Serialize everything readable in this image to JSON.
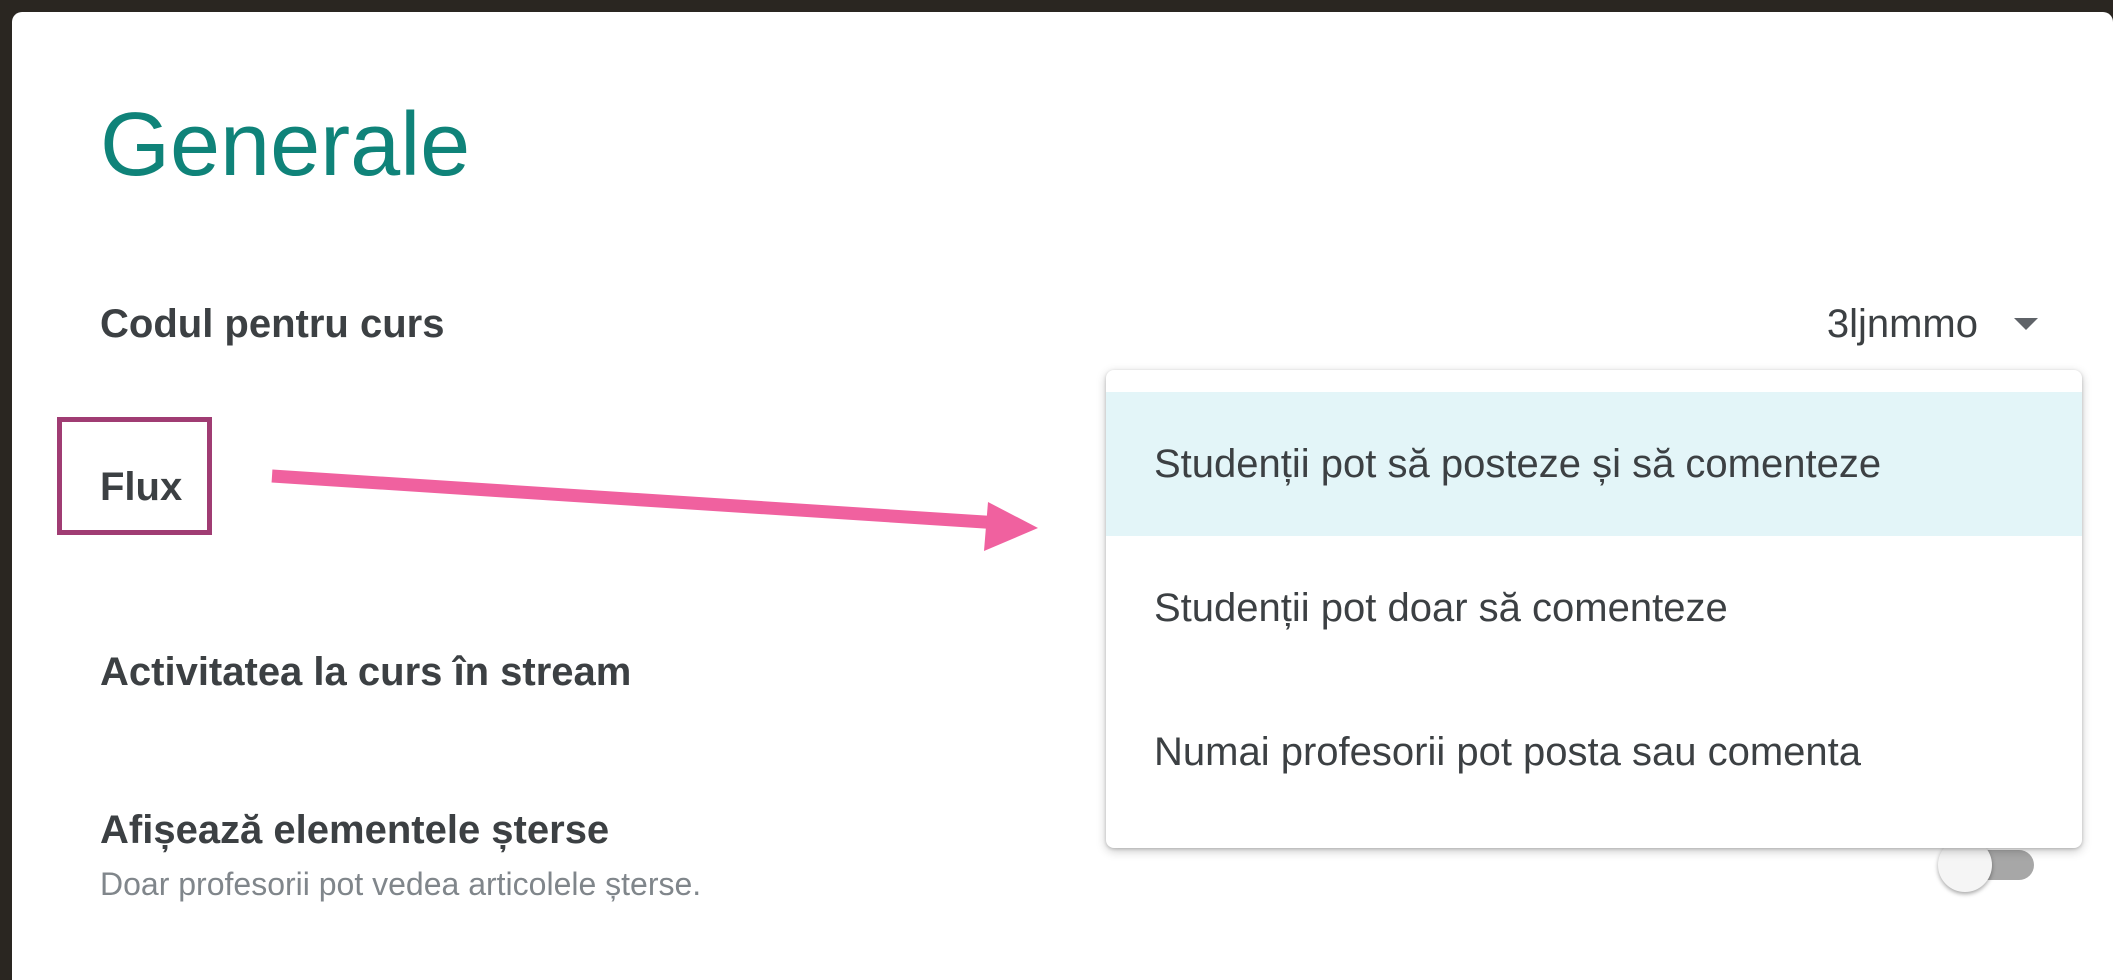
{
  "section": {
    "title": "Generale"
  },
  "settings": {
    "class_code": {
      "label": "Codul pentru curs",
      "value": "3ljnmmo"
    },
    "stream": {
      "label": "Flux"
    },
    "class_activity": {
      "label": "Activitatea la curs în stream"
    },
    "deleted_items": {
      "label": "Afișează elementele șterse",
      "description": "Doar profesorii pot vedea articolele șterse.",
      "toggle_state": "off"
    }
  },
  "stream_menu": {
    "options": [
      {
        "label": "Studenții pot să posteze și să comenteze",
        "selected": true
      },
      {
        "label": "Studenții pot doar să comenteze",
        "selected": false
      },
      {
        "label": "Numai profesorii pot posta sau comenta",
        "selected": false
      }
    ]
  },
  "annotation": {
    "highlight_color": "#a03c73",
    "arrow_color": "#f0619f",
    "arrow_icon": "arrow-right-icon"
  },
  "colors": {
    "title": "#0f8379",
    "selected_option_bg": "#e3f5f8",
    "page_border": "#2a2621"
  }
}
